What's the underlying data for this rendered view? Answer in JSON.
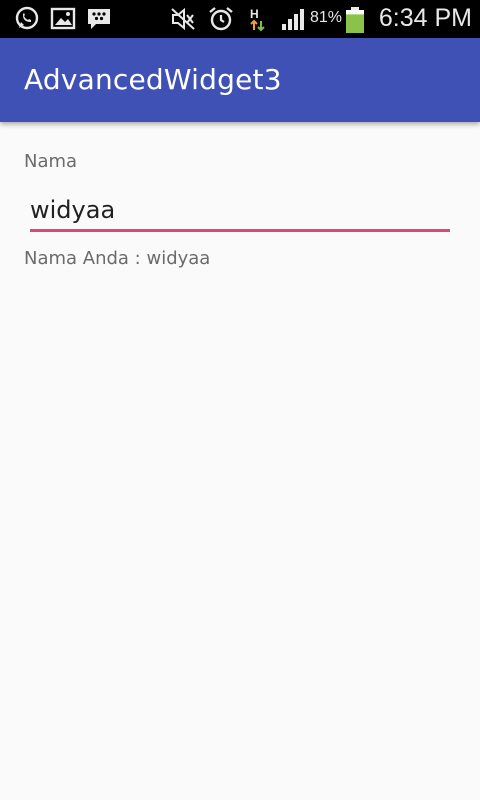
{
  "status_bar": {
    "left_icons": [
      "whatsapp-icon",
      "gallery-icon",
      "bbm-icon"
    ],
    "right_icons": [
      "mute-icon",
      "alarm-icon",
      "data-h-icon",
      "signal-icon"
    ],
    "battery_percent": "81%",
    "battery_level": 0.81,
    "battery_color": "#8bc34a",
    "time": "6:34 PM"
  },
  "app_bar": {
    "title": "AdvancedWidget3",
    "color": "#3f51b5"
  },
  "form": {
    "label": "Nama",
    "input_value": "widyaa",
    "underline_color": "#e0457b",
    "result": "Nama Anda : widyaa"
  }
}
